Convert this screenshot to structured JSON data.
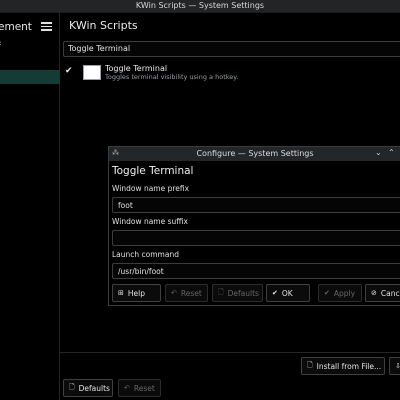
{
  "window": {
    "title": "KWin Scripts — System Settings"
  },
  "sidebar": {
    "breadcrumb": "ement",
    "back_label": "‹",
    "menu_icon": "hamburger-menu-icon"
  },
  "header": {
    "title": "KWin Scripts"
  },
  "search": {
    "value": "Toggle Terminal"
  },
  "scripts": [
    {
      "name": "Toggle Terminal",
      "description": "Toggles terminal visibility using a hotkey.",
      "enabled_mark": "✔"
    }
  ],
  "footer": {
    "install_label": "Install from File...",
    "defaults_label": "Defaults",
    "reset_label": "Reset"
  },
  "dialog": {
    "title": "Configure — System Settings",
    "heading": "Toggle Terminal",
    "fields": [
      {
        "label": "Window name prefix",
        "value": "foot"
      },
      {
        "label": "Window name suffix",
        "value": ""
      },
      {
        "label": "Launch command",
        "value": "/usr/bin/foot"
      }
    ],
    "buttons": {
      "help": "Help",
      "reset": "Reset",
      "defaults": "Defaults",
      "ok": "OK",
      "apply": "Apply",
      "cancel": "Cance"
    }
  },
  "colors": {
    "selection": "#143c36",
    "background": "#000000",
    "titlebar": "#222426"
  }
}
